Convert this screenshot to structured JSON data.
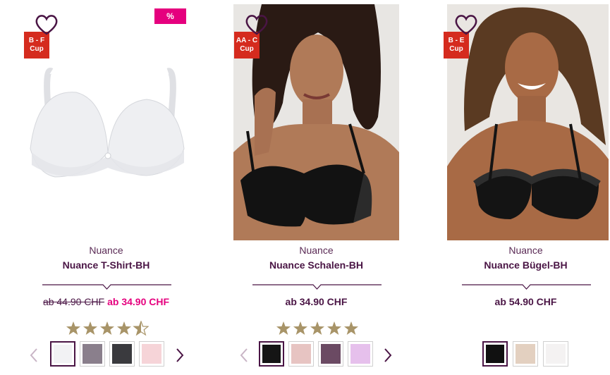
{
  "products": [
    {
      "brand": "Nuance",
      "name": "Nuance T-Shirt-BH",
      "cup_badge_line1": "B - F",
      "cup_badge_line2": "Cup",
      "sale_badge": "%",
      "old_price": "ab 44.90 CHF",
      "price": "ab 34.90 CHF",
      "rating": 4.5,
      "swatch_colors": [
        "#f2f2f4",
        "#8a7f8c",
        "#3a3a3e",
        "#f6d4d8"
      ],
      "selected_swatch": 0
    },
    {
      "brand": "Nuance",
      "name": "Nuance Schalen-BH",
      "cup_badge_line1": "AA - C",
      "cup_badge_line2": "Cup",
      "price": "ab 34.90 CHF",
      "rating": 5,
      "swatch_colors": [
        "#151515",
        "#e7c4c2",
        "#6b4a63",
        "#e6c0ec"
      ],
      "selected_swatch": 0
    },
    {
      "brand": "Nuance",
      "name": "Nuance Bügel-BH",
      "cup_badge_line1": "B - E",
      "cup_badge_line2": "Cup",
      "price": "ab 54.90 CHF",
      "swatch_colors": [
        "#111111",
        "#e3d0c0",
        "#f4f2f2"
      ],
      "selected_swatch": 0
    }
  ],
  "colors": {
    "brand_purple": "#4a1545",
    "sale_pink": "#e5007e",
    "cup_badge_red": "#d52b1e",
    "star_gold": "#a89468"
  },
  "icons": [
    "heart-outline-icon",
    "star-icon",
    "chevron-left-icon",
    "chevron-right-icon"
  ]
}
